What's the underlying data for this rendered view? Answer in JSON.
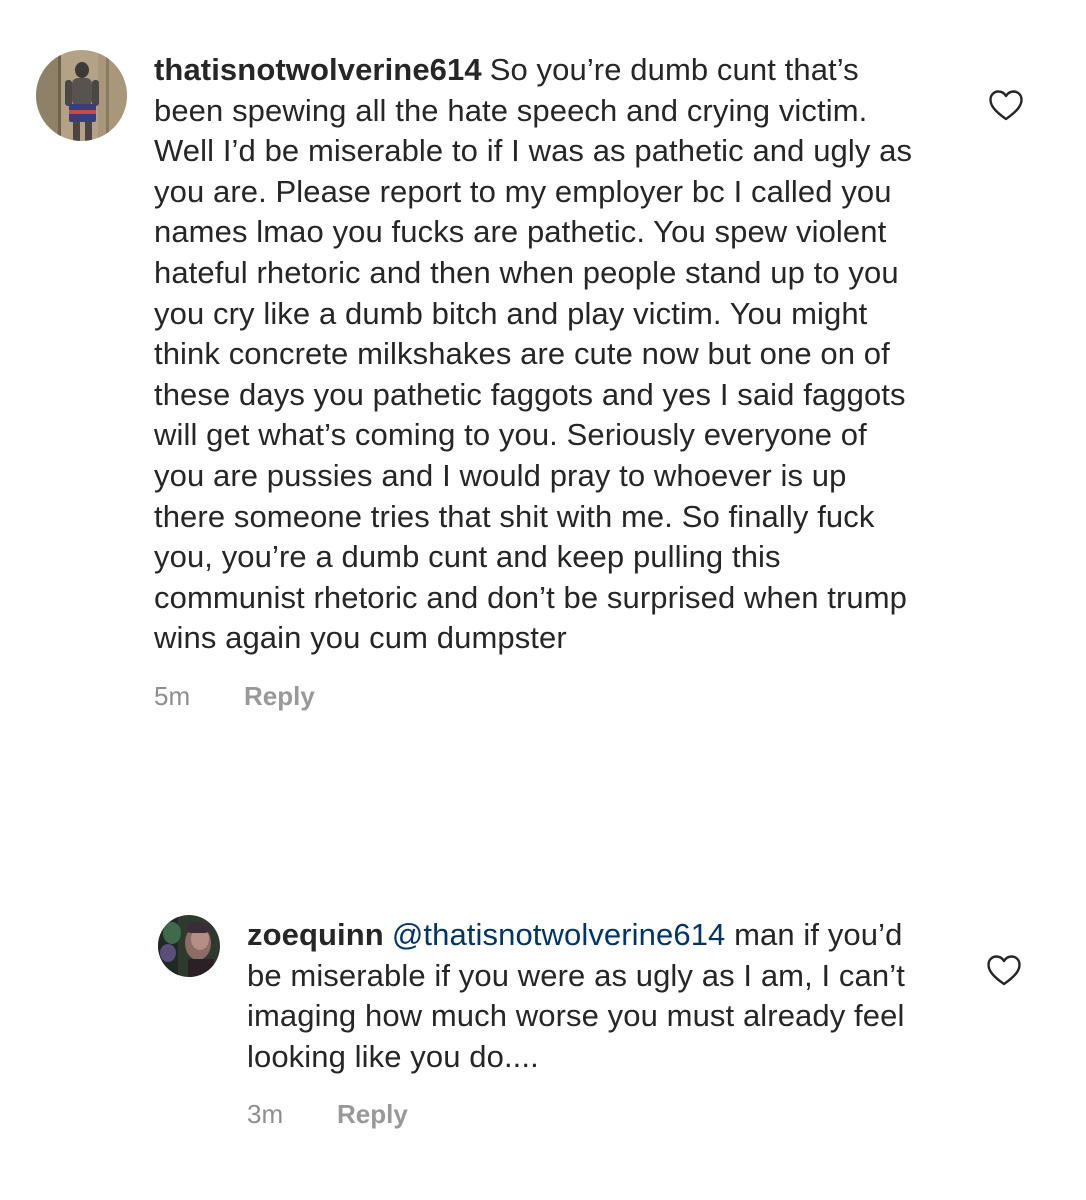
{
  "comments": [
    {
      "username": "thatisnotwolverine614",
      "text": "So you’re dumb cunt that’s been spewing all the hate speech and crying victim.  Well I’d be miserable to if I was as pathetic and ugly as you are.  Please report to my employer bc I called you names lmao you fucks are pathetic.  You spew violent hateful rhetoric and then when people stand up to you you cry like a dumb bitch and play victim.  You might think concrete milkshakes are cute now but one on of these days you pathetic faggots and yes I said faggots will get what’s coming to you.  Seriously everyone of you are pussies and I would pray to whoever is up there someone tries that shit with me.  So finally fuck you, you’re a dumb cunt and keep pulling this communist rhetoric and don’t be surprised when trump wins again you cum dumpster",
      "time": "5m",
      "reply_label": "Reply",
      "like_icon": "heart-outline-icon"
    },
    {
      "username": "zoequinn",
      "mention": "@thatisnotwolverine614",
      "text": "man if you’d be miserable if you were as ugly as I am, I can’t imaging how much worse you must already feel looking like you do....",
      "time": "3m",
      "reply_label": "Reply",
      "like_icon": "heart-outline-icon"
    }
  ],
  "colors": {
    "text": "#262626",
    "mention": "#003569",
    "meta": "#8e8e8e",
    "reply": "#999999"
  }
}
